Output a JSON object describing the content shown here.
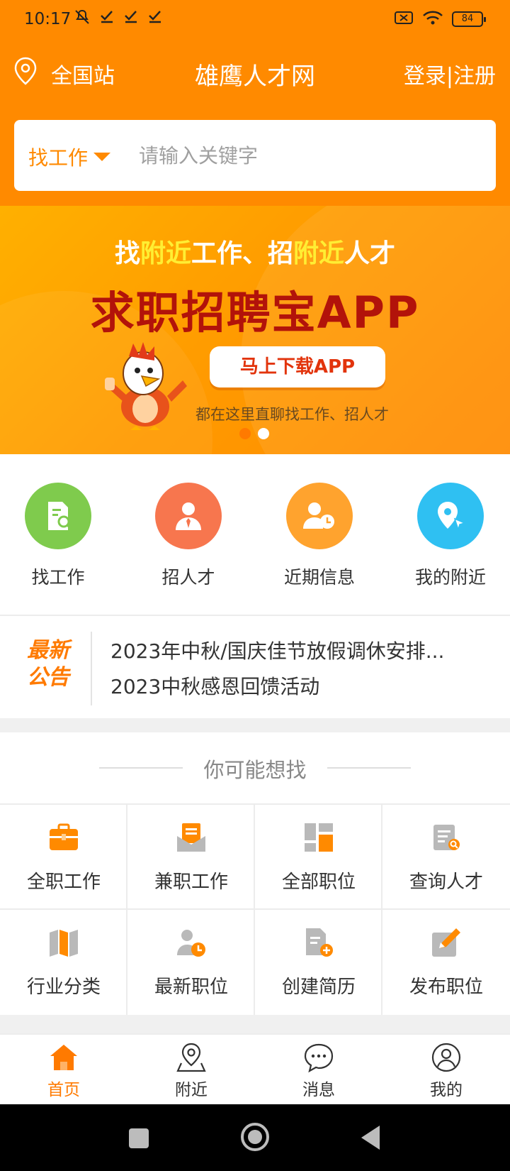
{
  "status_bar": {
    "time": "10:17",
    "left_icons": [
      "mute-icon",
      "check-icon",
      "check-icon",
      "check-icon"
    ],
    "battery": "84"
  },
  "top_bar": {
    "station": "全国站",
    "title": "雄鹰人才网",
    "login": "登录|注册"
  },
  "search": {
    "type": "找工作",
    "placeholder": "请输入关键字"
  },
  "banner": {
    "line1_parts": [
      "找",
      "附近",
      "工作、招",
      "附近",
      "人才"
    ],
    "line2": "求职招聘宝APP",
    "button": "马上下载APP",
    "subtitle": "都在这里直聊找工作、招人才",
    "page_count": 2,
    "active_page": 1
  },
  "quick_links": [
    {
      "label": "找工作",
      "icon": "find-job-icon",
      "color": "#7fcb4d"
    },
    {
      "label": "招人才",
      "icon": "recruit-icon",
      "color": "#f7764e"
    },
    {
      "label": "近期信息",
      "icon": "recent-info-icon",
      "color": "#ffa32e"
    },
    {
      "label": "我的附近",
      "icon": "nearby-location-icon",
      "color": "#2fc0f2"
    }
  ],
  "notice": {
    "badge_line1": "最新",
    "badge_line2": "公告",
    "items": [
      "2023年中秋/国庆佳节放假调休安排...",
      "2023中秋感恩回馈活动"
    ]
  },
  "want": {
    "title": "你可能想找",
    "items": [
      {
        "label": "全职工作",
        "icon": "briefcase-icon"
      },
      {
        "label": "兼职工作",
        "icon": "envelope-doc-icon"
      },
      {
        "label": "全部职位",
        "icon": "grid-blocks-icon"
      },
      {
        "label": "查询人才",
        "icon": "search-document-icon"
      },
      {
        "label": "行业分类",
        "icon": "map-folds-icon"
      },
      {
        "label": "最新职位",
        "icon": "person-clock-icon"
      },
      {
        "label": "创建简历",
        "icon": "document-add-icon"
      },
      {
        "label": "发布职位",
        "icon": "edit-pen-icon"
      }
    ]
  },
  "bottom_nav": [
    {
      "label": "首页",
      "icon": "home-icon",
      "active": true
    },
    {
      "label": "附近",
      "icon": "map-pin-icon",
      "active": false
    },
    {
      "label": "消息",
      "icon": "chat-bubble-icon",
      "active": false
    },
    {
      "label": "我的",
      "icon": "user-icon",
      "active": false
    }
  ],
  "colors": {
    "brand": "#ff8a00",
    "accent": "#ff7a00",
    "banner_title": "#b2130a",
    "icon_grey": "#b9b9b9"
  }
}
